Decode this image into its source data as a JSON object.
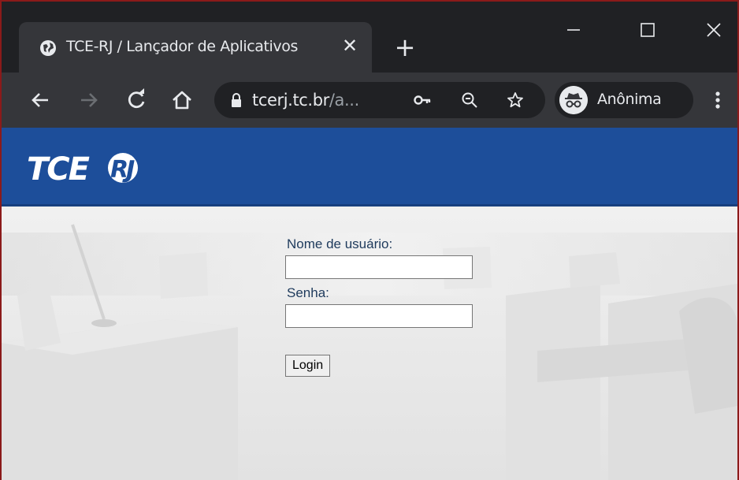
{
  "browser": {
    "tab": {
      "title": "TCE-RJ / Lançador de Aplicativos",
      "close_icon": "close-icon",
      "favicon": "globe-icon"
    },
    "new_tab": "+",
    "address": {
      "host": "tcerj.tc.br",
      "path_truncated": "/a...",
      "icons": [
        "key-icon",
        "zoom-icon",
        "star-icon"
      ]
    },
    "profile_label": "Anônima",
    "colors": {
      "frame": "#202124",
      "toolbar": "#35363a",
      "text": "#e8eaed"
    }
  },
  "page": {
    "header": {
      "logo_text": "TCERJ",
      "color": "#1d4e9a"
    },
    "form": {
      "username_label": "Nome de usuário:",
      "username_value": "",
      "password_label": "Senha:",
      "password_value": "",
      "login_button": "Login"
    }
  }
}
